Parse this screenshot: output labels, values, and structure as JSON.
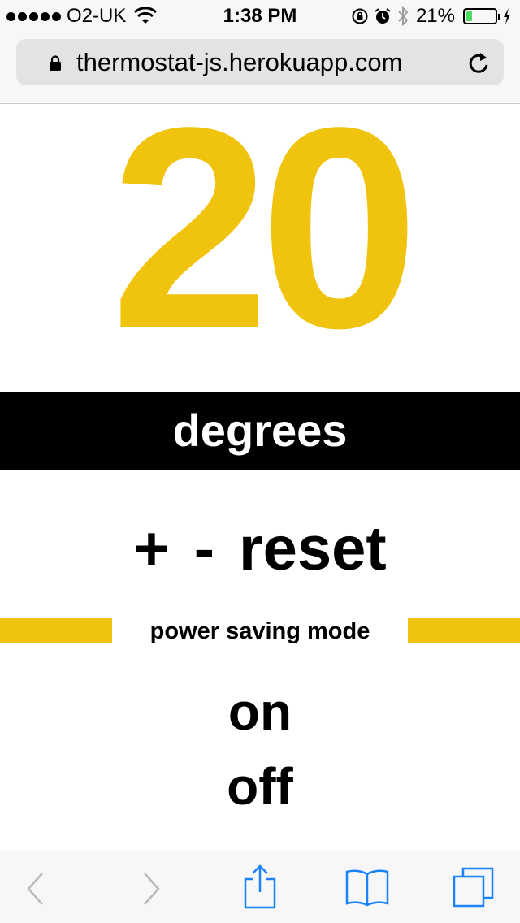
{
  "status_bar": {
    "carrier": "O2-UK",
    "time": "1:38 PM",
    "battery_percent": "21%",
    "battery_level": 0.21,
    "icons": [
      "signal-icon",
      "wifi-icon",
      "rotation-lock-icon",
      "alarm-icon",
      "bluetooth-icon",
      "battery-icon",
      "charging-icon"
    ]
  },
  "browser": {
    "url": "thermostat-js.herokuapp.com",
    "icons": [
      "lock-icon",
      "reload-icon"
    ]
  },
  "thermostat": {
    "temperature": "20",
    "unit_label": "degrees",
    "increase_label": "+",
    "decrease_label": "-",
    "reset_label": "reset",
    "power_saving_label": "power saving mode",
    "on_label": "on",
    "off_label": "off"
  },
  "toolbar": {
    "icons": [
      "back-icon",
      "forward-icon",
      "share-icon",
      "bookmarks-icon",
      "tabs-icon"
    ]
  },
  "colors": {
    "accent_yellow": "#f0c30f",
    "band_black": "#000000",
    "ios_blue": "#1a82fb",
    "battery_green": "#4cd964"
  }
}
